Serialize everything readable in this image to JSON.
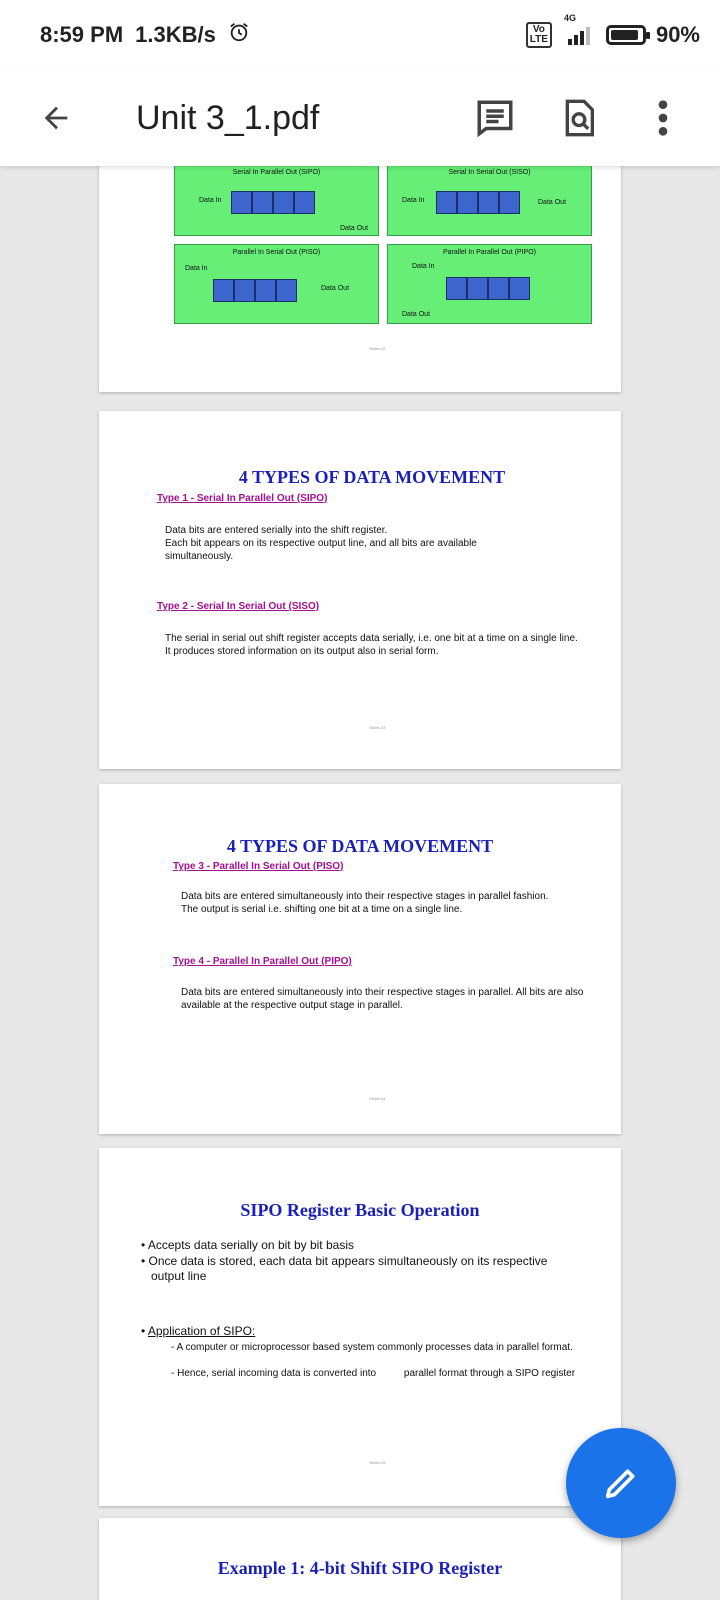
{
  "status": {
    "time": "8:59 PM",
    "speed": "1.3KB/s",
    "volte": "Vo LTE",
    "network": "4G",
    "battery_percent": "90%",
    "battery_level": 0.9
  },
  "appbar": {
    "title": "Unit 3_1.pdf"
  },
  "pages": {
    "p1": {
      "sipo_title": "Serial In Parallel Out (SIPO)",
      "siso_title": "Serial In Serial Out (SISO)",
      "piso_title": "Parallel In Serial Out (PISO)",
      "pipo_title": "Parallel In Parallel Out (PIPO)",
      "data_in": "Data In",
      "data_out": "Data Out",
      "slide": "Slides 42"
    },
    "p2": {
      "heading": "4 TYPES OF DATA MOVEMENT",
      "type1": "Type 1 - Serial In Parallel Out (SIPO)",
      "type1_text": "Data bits are entered serially into the shift register.\nEach bit appears on its respective output line, and all bits are available simultaneously.",
      "type2": "Type 2 - Serial In Serial Out (SISO)",
      "type2_text": "The serial in serial out shift register accepts data serially, i.e. one bit at a time on a single line.\nIt produces stored information on its output also in serial form.",
      "slide": "Slides 43"
    },
    "p3": {
      "heading": "4 TYPES OF DATA MOVEMENT",
      "type3": "Type 3 - Parallel In Serial Out (PISO)",
      "type3_text": "Data bits are entered simultaneously into their respective stages in parallel fashion.\nThe output is serial i.e. shifting one bit at a time on a single line.",
      "type4": "Type 4 - Parallel In Parallel Out (PIPO)",
      "type4_text": "Data bits are entered simultaneously into their respective stages in parallel. All bits are also available at the respective output stage in parallel.",
      "slide": "Slides 44"
    },
    "p4": {
      "heading": "SIPO Register Basic Operation",
      "bullet1": "Accepts data serially on bit by bit basis",
      "bullet2": "Once data is stored, each data bit appears simultaneously on its respective output line",
      "bullet3": "Application of SIPO:",
      "sub1": "- A computer or microprocessor based system commonly processes data in parallel format.",
      "sub2": "- Hence, serial incoming data is converted into          parallel format through a SIPO register",
      "slide": "Slides 45"
    },
    "p5": {
      "heading": "Example 1: 4-bit Shift SIPO Register"
    }
  },
  "colors": {
    "accent": "#1a73e8",
    "heading_blue": "#1a20b8",
    "link_purple": "#a01090",
    "diagram_green": "#66ee77",
    "register_blue": "#3c66cc"
  },
  "icons": {
    "back": "arrow-left-icon",
    "comments": "comment-icon",
    "find": "search-document-icon",
    "more": "more-vert-icon",
    "edit": "pencil-icon"
  }
}
